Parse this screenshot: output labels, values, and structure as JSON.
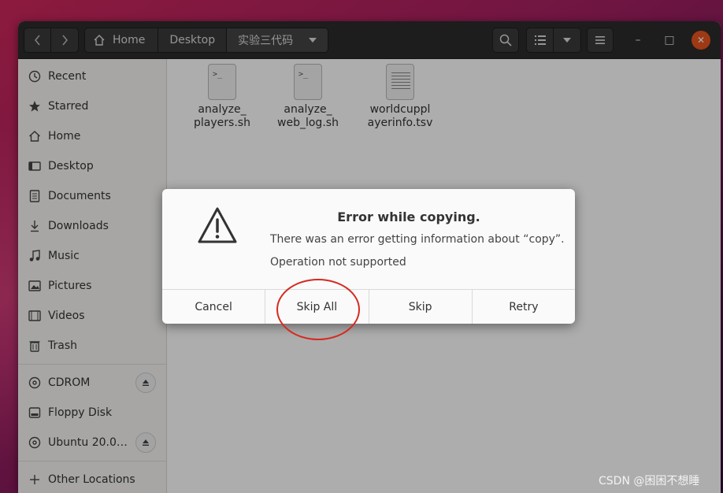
{
  "headerbar": {
    "back_icon": "chevron-left-icon",
    "forward_icon": "chevron-right-icon",
    "path": [
      "Home",
      "Desktop",
      "实验三代码"
    ],
    "path_dropdown_icon": "chevron-down-icon",
    "search_icon": "search-icon",
    "view_list_icon": "list-view-icon",
    "view_options_icon": "chevron-down-icon",
    "menu_icon": "hamburger-menu-icon",
    "minimize_label": "–",
    "maximize_label": "□",
    "close_label": "✕"
  },
  "sidebar": {
    "places": [
      {
        "label": "Recent",
        "icon": "clock-icon"
      },
      {
        "label": "Starred",
        "icon": "star-icon"
      },
      {
        "label": "Home",
        "icon": "home-icon"
      },
      {
        "label": "Desktop",
        "icon": "desktop-icon"
      },
      {
        "label": "Documents",
        "icon": "document-icon"
      },
      {
        "label": "Downloads",
        "icon": "download-icon"
      },
      {
        "label": "Music",
        "icon": "music-icon"
      },
      {
        "label": "Pictures",
        "icon": "picture-icon"
      },
      {
        "label": "Videos",
        "icon": "video-icon"
      },
      {
        "label": "Trash",
        "icon": "trash-icon"
      }
    ],
    "devices": [
      {
        "label": "CDROM",
        "icon": "disc-icon",
        "eject": true
      },
      {
        "label": "Floppy Disk",
        "icon": "drive-icon",
        "eject": false
      },
      {
        "label": "Ubuntu 20.0…",
        "icon": "disc-icon",
        "eject": true
      }
    ],
    "other": {
      "label": "Other Locations",
      "icon": "plus-icon"
    }
  },
  "files": [
    {
      "name": "analyze_\nplayers.sh",
      "type": "script"
    },
    {
      "name": "analyze_\nweb_log.sh",
      "type": "script"
    },
    {
      "name": "worldcuppl\nayerinfo.tsv",
      "type": "text"
    }
  ],
  "dialog": {
    "icon": "warning-icon",
    "title": "Error while copying.",
    "message": "There was an error getting information about “copy”.",
    "detail": "Operation not supported",
    "buttons": [
      "Cancel",
      "Skip All",
      "Skip",
      "Retry"
    ]
  },
  "watermark": "CSDN @困困不想睡",
  "colors": {
    "headerbar": "#2c2c2c",
    "close_button": "#e95420",
    "annotation": "#d62a1f"
  }
}
